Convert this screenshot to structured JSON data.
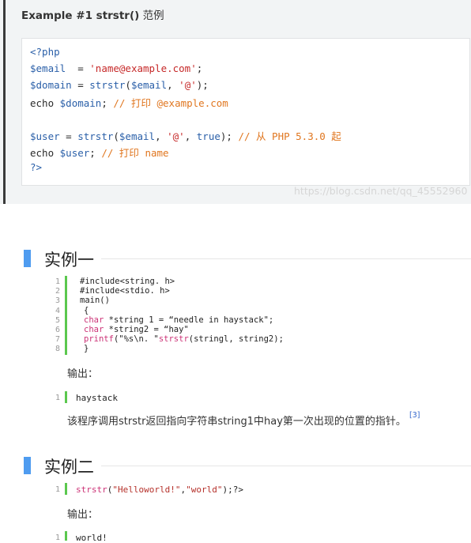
{
  "php_example": {
    "title_bold": "Example #1 strstr()",
    "title_rest": " 范例",
    "lines": [
      [
        {
          "t": "<?php",
          "c": "php-tag"
        }
      ],
      [
        {
          "t": "$email",
          "c": "kw-blue"
        },
        {
          "t": "  = ",
          "c": ""
        },
        {
          "t": "'name@example.com'",
          "c": "str-red"
        },
        {
          "t": ";",
          "c": ""
        }
      ],
      [
        {
          "t": "$domain",
          "c": "kw-blue"
        },
        {
          "t": " = ",
          "c": ""
        },
        {
          "t": "strstr",
          "c": "kw-blue"
        },
        {
          "t": "(",
          "c": ""
        },
        {
          "t": "$email",
          "c": "kw-blue"
        },
        {
          "t": ", ",
          "c": ""
        },
        {
          "t": "'@'",
          "c": "str-red"
        },
        {
          "t": ");",
          "c": ""
        }
      ],
      [
        {
          "t": "echo ",
          "c": ""
        },
        {
          "t": "$domain",
          "c": "kw-blue"
        },
        {
          "t": "; ",
          "c": ""
        },
        {
          "t": "// 打印 @example.com",
          "c": "cm-orange"
        }
      ],
      [
        {
          "t": "",
          "c": ""
        }
      ],
      [
        {
          "t": "$user",
          "c": "kw-blue"
        },
        {
          "t": " = ",
          "c": ""
        },
        {
          "t": "strstr",
          "c": "kw-blue"
        },
        {
          "t": "(",
          "c": ""
        },
        {
          "t": "$email",
          "c": "kw-blue"
        },
        {
          "t": ", ",
          "c": ""
        },
        {
          "t": "'@'",
          "c": "str-red"
        },
        {
          "t": ", ",
          "c": ""
        },
        {
          "t": "true",
          "c": "kw-blue"
        },
        {
          "t": "); ",
          "c": ""
        },
        {
          "t": "// 从 PHP 5.3.0 起",
          "c": "cm-orange"
        }
      ],
      [
        {
          "t": "echo ",
          "c": ""
        },
        {
          "t": "$user",
          "c": "kw-blue"
        },
        {
          "t": "; ",
          "c": ""
        },
        {
          "t": "// 打印 name",
          "c": "cm-orange"
        }
      ],
      [
        {
          "t": "?>",
          "c": "php-tag"
        }
      ]
    ],
    "watermark": "https://blog.csdn.net/qq_45552960"
  },
  "example1": {
    "heading": "实例一",
    "line_numbers": [
      "1",
      "2",
      "3",
      "4",
      "5",
      "6",
      "7",
      "8"
    ],
    "lines": [
      [
        {
          "t": "#include<string. h>",
          "c": ""
        }
      ],
      [
        {
          "t": "#include<stdio. h>",
          "c": ""
        }
      ],
      [
        {
          "t": "main()",
          "c": ""
        }
      ],
      [
        {
          "t": "{",
          "c": ""
        }
      ],
      [
        {
          "t": "char",
          "c": "fn-pink"
        },
        {
          "t": " *string 1 = “needle in haystack\";",
          "c": ""
        }
      ],
      [
        {
          "t": "char",
          "c": "fn-pink"
        },
        {
          "t": " *string2 = “hay\"",
          "c": ""
        }
      ],
      [
        {
          "t": "printf",
          "c": "fn-pink"
        },
        {
          "t": "(\"%s\\n. \"",
          "c": ""
        },
        {
          "t": "strstr",
          "c": "fn-pink"
        },
        {
          "t": "(stringl, string2);",
          "c": ""
        }
      ],
      [
        {
          "t": "}",
          "c": ""
        }
      ]
    ],
    "output_label": "输出：",
    "output_line_number": "1",
    "output_text": "haystack",
    "description": "该程序调用strstr返回指向字符串string1中hay第一次出现的位置的指针。",
    "footnote": "[3]"
  },
  "example2": {
    "heading": "实例二",
    "line_number": "1",
    "code": [
      {
        "t": "strstr",
        "c": "fn-pink"
      },
      {
        "t": "(",
        "c": ""
      },
      {
        "t": "\"Helloworld!\"",
        "c": "string-red"
      },
      {
        "t": ",",
        "c": ""
      },
      {
        "t": "\"world\"",
        "c": "string-red"
      },
      {
        "t": ");?>",
        "c": ""
      }
    ],
    "output_label": "输出：",
    "output_line_number": "1",
    "output_text": "world!"
  },
  "colors": {
    "accent_bar": "#4f9cf0",
    "gutter_bar": "#5bc84e",
    "php_var": "#2a5fa8",
    "php_string": "#c62929",
    "php_comment": "#e0761f"
  }
}
